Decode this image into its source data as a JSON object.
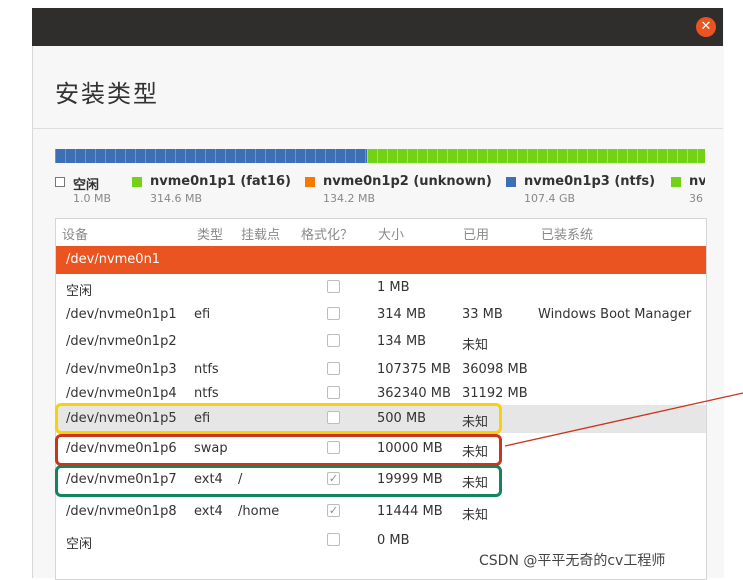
{
  "window": {
    "title": "安装类型",
    "close_glyph": "✕"
  },
  "partition_bar": [
    {
      "type": "blue",
      "fraction": 0.48
    },
    {
      "type": "green",
      "fraction": 0.52
    }
  ],
  "legend": [
    {
      "name": "空闲",
      "size": "1.0 MB",
      "color": "#ffffff"
    },
    {
      "name": "nvme0n1p1 (fat16)",
      "size": "314.6 MB",
      "color": "#73d216"
    },
    {
      "name": "nvme0n1p2 (unknown)",
      "size": "134.2 MB",
      "color": "#f57900"
    },
    {
      "name": "nvme0n1p3 (ntfs)",
      "size": "107.4 GB",
      "color": "#3d6fb4"
    },
    {
      "name": "nv",
      "size": "36",
      "color": "#73d216"
    }
  ],
  "table": {
    "headers": [
      "设备",
      "类型",
      "挂载点",
      "格式化？",
      "大小",
      "已用",
      "已装系统"
    ],
    "rows": [
      {
        "device": "/dev/nvme0n1",
        "type": "",
        "mount": "",
        "format": null,
        "size": "",
        "used": "",
        "system": "",
        "state": "selected"
      },
      {
        "device": "空闲",
        "type": "",
        "mount": "",
        "format": false,
        "size": "1 MB",
        "used": "",
        "system": ""
      },
      {
        "device": "/dev/nvme0n1p1",
        "type": "efi",
        "mount": "",
        "format": false,
        "size": "314 MB",
        "used": "33 MB",
        "system": "Windows Boot Manager"
      },
      {
        "device": "/dev/nvme0n1p2",
        "type": "",
        "mount": "",
        "format": false,
        "size": "134 MB",
        "used": "未知",
        "system": ""
      },
      {
        "device": "/dev/nvme0n1p3",
        "type": "ntfs",
        "mount": "",
        "format": false,
        "size": "107375 MB",
        "used": "36098 MB",
        "system": ""
      },
      {
        "device": "/dev/nvme0n1p4",
        "type": "ntfs",
        "mount": "",
        "format": false,
        "size": "362340 MB",
        "used": "31192 MB",
        "system": ""
      },
      {
        "device": "/dev/nvme0n1p5",
        "type": "efi",
        "mount": "",
        "format": false,
        "size": "500 MB",
        "used": "未知",
        "system": "",
        "state": "grey"
      },
      {
        "device": "/dev/nvme0n1p6",
        "type": "swap",
        "mount": "",
        "format": false,
        "size": "10000 MB",
        "used": "未知",
        "system": ""
      },
      {
        "device": "/dev/nvme0n1p7",
        "type": "ext4",
        "mount": "/",
        "format": true,
        "size": "19999 MB",
        "used": "未知",
        "system": ""
      },
      {
        "device": "/dev/nvme0n1p8",
        "type": "ext4",
        "mount": "/home",
        "format": true,
        "size": "11444 MB",
        "used": "未知",
        "system": ""
      },
      {
        "device": "空闲",
        "type": "",
        "mount": "",
        "format": false,
        "size": "0 MB",
        "used": "",
        "system": ""
      }
    ]
  },
  "check_glyph": "✓",
  "watermark": "CSDN @平平无奇的cv工程师"
}
